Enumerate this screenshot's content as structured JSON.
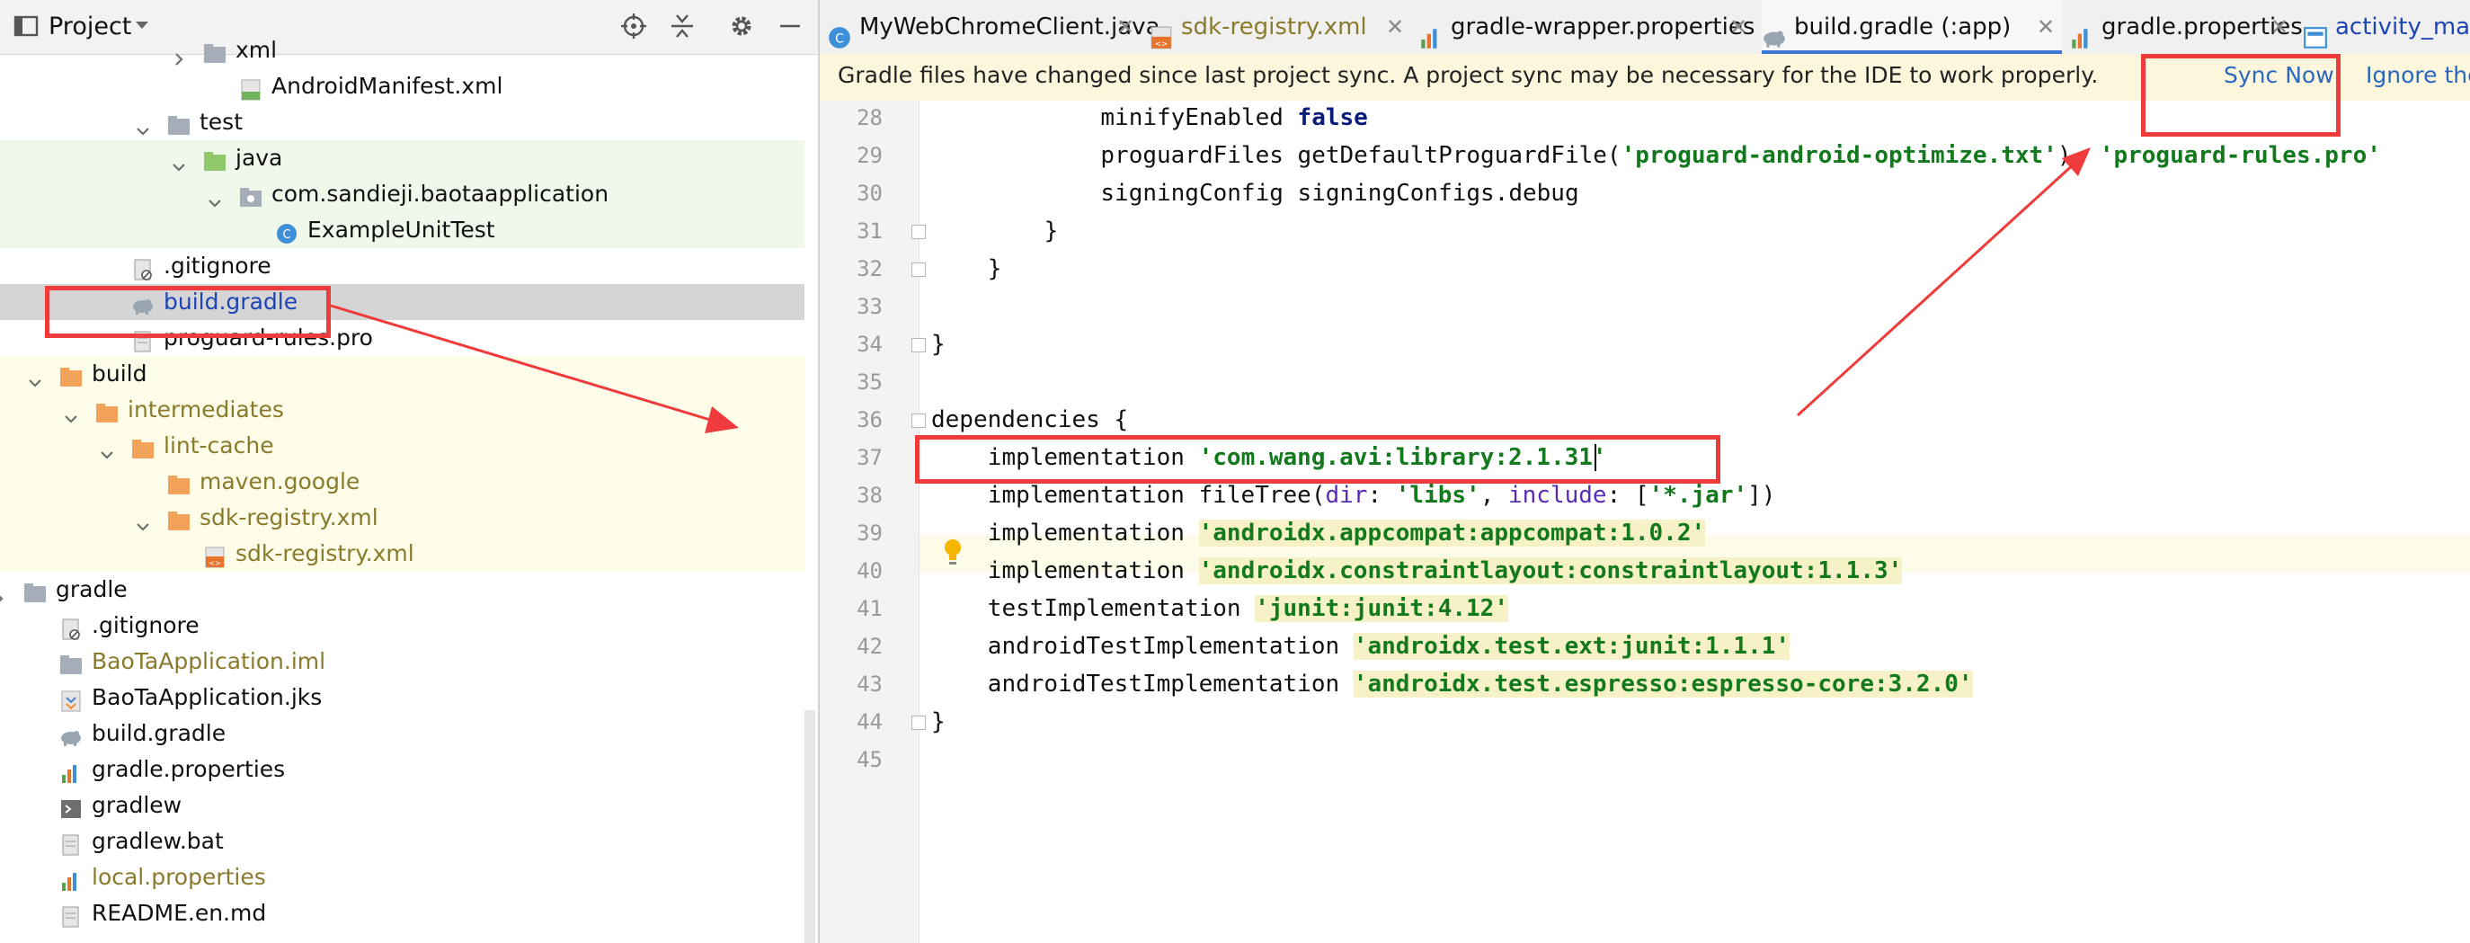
{
  "project_panel": {
    "title": "Project",
    "tree": [
      {
        "label": "xml",
        "icon": "folder",
        "indent": 1,
        "chevron": "right",
        "bg": "none",
        "color": "dark"
      },
      {
        "label": "AndroidManifest.xml",
        "icon": "manifest",
        "indent": 2,
        "chevron": "none",
        "bg": "none",
        "color": "dark"
      },
      {
        "label": "test",
        "icon": "folder",
        "indent": 0,
        "chevron": "down",
        "bg": "none",
        "color": "dark"
      },
      {
        "label": "java",
        "icon": "green-folder",
        "indent": 1,
        "chevron": "down",
        "bg": "green",
        "color": "dark"
      },
      {
        "label": "com.sandieji.baotaapplication",
        "icon": "package",
        "indent": 2,
        "chevron": "down",
        "bg": "green",
        "color": "dark"
      },
      {
        "label": "ExampleUnitTest",
        "icon": "class",
        "indent": 3,
        "chevron": "none",
        "bg": "green",
        "color": "dark"
      },
      {
        "label": ".gitignore",
        "icon": "gitignore",
        "indent": -1,
        "chevron": "none",
        "bg": "none",
        "color": "dark"
      },
      {
        "label": "build.gradle",
        "icon": "gradle",
        "indent": -1,
        "chevron": "none",
        "bg": "selected",
        "color": "blue"
      },
      {
        "label": "proguard-rules.pro",
        "icon": "file",
        "indent": -1,
        "chevron": "none",
        "bg": "none",
        "color": "dark"
      },
      {
        "label": "build",
        "icon": "orange-folder",
        "indent": -3,
        "chevron": "down",
        "bg": "yellow",
        "color": "dark"
      },
      {
        "label": "intermediates",
        "icon": "orange-folder",
        "indent": -2,
        "chevron": "down",
        "bg": "yellow",
        "color": "olive"
      },
      {
        "label": "lint-cache",
        "icon": "orange-folder",
        "indent": -1,
        "chevron": "down",
        "bg": "yellow",
        "color": "olive"
      },
      {
        "label": "maven.google",
        "icon": "orange-folder",
        "indent": 0,
        "chevron": "none",
        "bg": "yellow",
        "color": "olive"
      },
      {
        "label": "sdk-registry.xml",
        "icon": "orange-folder",
        "indent": 0,
        "chevron": "down",
        "bg": "yellow",
        "color": "olive"
      },
      {
        "label": "sdk-registry.xml",
        "icon": "xml-file",
        "indent": 1,
        "chevron": "none",
        "bg": "yellow",
        "color": "olive"
      },
      {
        "label": "gradle",
        "icon": "folder",
        "indent": -4,
        "chevron": "right",
        "bg": "none",
        "color": "dark"
      },
      {
        "label": ".gitignore",
        "icon": "gitignore",
        "indent": -3,
        "chevron": "none",
        "bg": "none",
        "color": "dark"
      },
      {
        "label": "BaoTaApplication.iml",
        "icon": "iml",
        "indent": -3,
        "chevron": "none",
        "bg": "none",
        "color": "olive"
      },
      {
        "label": "BaoTaApplication.jks",
        "icon": "jks",
        "indent": -3,
        "chevron": "none",
        "bg": "none",
        "color": "dark"
      },
      {
        "label": "build.gradle",
        "icon": "gradle",
        "indent": -3,
        "chevron": "none",
        "bg": "none",
        "color": "dark"
      },
      {
        "label": "gradle.properties",
        "icon": "properties",
        "indent": -3,
        "chevron": "none",
        "bg": "none",
        "color": "dark"
      },
      {
        "label": "gradlew",
        "icon": "shell",
        "indent": -3,
        "chevron": "none",
        "bg": "none",
        "color": "dark"
      },
      {
        "label": "gradlew.bat",
        "icon": "file",
        "indent": -3,
        "chevron": "none",
        "bg": "none",
        "color": "dark"
      },
      {
        "label": "local.properties",
        "icon": "properties",
        "indent": -3,
        "chevron": "none",
        "bg": "none",
        "color": "olive"
      },
      {
        "label": "README.en.md",
        "icon": "file",
        "indent": -3,
        "chevron": "none",
        "bg": "none",
        "color": "dark"
      }
    ]
  },
  "tabs": [
    {
      "label": "MyWebChromeClient.java",
      "icon": "java-class",
      "active": false,
      "closable": true,
      "color": "dark"
    },
    {
      "label": "sdk-registry.xml",
      "icon": "xml-file",
      "active": false,
      "closable": true,
      "color": "olive"
    },
    {
      "label": "gradle-wrapper.properties",
      "icon": "properties",
      "active": false,
      "closable": true,
      "color": "dark"
    },
    {
      "label": "build.gradle (:app)",
      "icon": "gradle",
      "active": true,
      "closable": true,
      "color": "dark"
    },
    {
      "label": "gradle.properties",
      "icon": "properties",
      "active": false,
      "closable": true,
      "color": "dark"
    },
    {
      "label": "activity_ma",
      "icon": "layout",
      "active": false,
      "closable": false,
      "color": "blue"
    }
  ],
  "banner": {
    "message": "Gradle files have changed since last project sync. A project sync may be necessary for the IDE to work properly.",
    "sync_now": "Sync Now",
    "ignore": "Ignore the"
  },
  "editor": {
    "lines": [
      {
        "n": "28",
        "indent": 12,
        "parts": [
          {
            "t": "minifyEnabled ",
            "s": ""
          },
          {
            "t": "false",
            "s": "kw"
          }
        ]
      },
      {
        "n": "29",
        "indent": 12,
        "parts": [
          {
            "t": "proguardFiles getDefaultProguardFile(",
            "s": ""
          },
          {
            "t": "'proguard-android-optimize.txt'",
            "s": "str"
          },
          {
            "t": "), ",
            "s": ""
          },
          {
            "t": "'proguard-rules.pro'",
            "s": "str"
          }
        ]
      },
      {
        "n": "30",
        "indent": 12,
        "parts": [
          {
            "t": "signingConfig signingConfigs.debug",
            "s": ""
          }
        ]
      },
      {
        "n": "31",
        "indent": 8,
        "parts": [
          {
            "t": "}",
            "s": ""
          }
        ]
      },
      {
        "n": "32",
        "indent": 4,
        "parts": [
          {
            "t": "}",
            "s": ""
          }
        ]
      },
      {
        "n": "33",
        "indent": 0,
        "parts": []
      },
      {
        "n": "34",
        "indent": 0,
        "parts": [
          {
            "t": "}",
            "s": ""
          }
        ]
      },
      {
        "n": "35",
        "indent": 0,
        "parts": []
      },
      {
        "n": "36",
        "indent": 0,
        "parts": [
          {
            "t": "dependencies {",
            "s": ""
          }
        ]
      },
      {
        "n": "37",
        "indent": 4,
        "parts": [
          {
            "t": "implementation ",
            "s": ""
          },
          {
            "t": "'com.wang.avi:library:2.1.31'",
            "s": "str"
          }
        ]
      },
      {
        "n": "38",
        "indent": 4,
        "parts": [
          {
            "t": "implementation fileTree(",
            "s": ""
          },
          {
            "t": "dir",
            "s": "param"
          },
          {
            "t": ": ",
            "s": ""
          },
          {
            "t": "'libs'",
            "s": "str"
          },
          {
            "t": ", ",
            "s": ""
          },
          {
            "t": "include",
            "s": "param"
          },
          {
            "t": ": [",
            "s": ""
          },
          {
            "t": "'*.jar'",
            "s": "str"
          },
          {
            "t": "])",
            "s": ""
          }
        ]
      },
      {
        "n": "39",
        "indent": 4,
        "parts": [
          {
            "t": "implementation ",
            "s": ""
          },
          {
            "t": "'androidx.appcompat:appcompat:1.0.2'",
            "s": "strhl"
          }
        ]
      },
      {
        "n": "40",
        "indent": 4,
        "parts": [
          {
            "t": "implementation ",
            "s": ""
          },
          {
            "t": "'androidx.constraintlayout:constraintlayout:1.1.3'",
            "s": "strhl"
          }
        ]
      },
      {
        "n": "41",
        "indent": 4,
        "parts": [
          {
            "t": "testImplementation ",
            "s": ""
          },
          {
            "t": "'junit:junit:4.12'",
            "s": "strhl"
          }
        ]
      },
      {
        "n": "42",
        "indent": 4,
        "parts": [
          {
            "t": "androidTestImplementation ",
            "s": ""
          },
          {
            "t": "'androidx.test.ext:junit:1.1.1'",
            "s": "strhl"
          }
        ]
      },
      {
        "n": "43",
        "indent": 4,
        "parts": [
          {
            "t": "androidTestImplementation ",
            "s": ""
          },
          {
            "t": "'androidx.test.espresso:espresso-core:3.2.0'",
            "s": "strhl"
          }
        ]
      },
      {
        "n": "44",
        "indent": 0,
        "parts": [
          {
            "t": "}",
            "s": ""
          }
        ]
      },
      {
        "n": "45",
        "indent": 0,
        "parts": []
      }
    ]
  },
  "colors": {
    "annotation": "#ef3b3b",
    "accent": "#3c77d4",
    "string": "#127a1c",
    "keyword": "#0a1c7a"
  }
}
